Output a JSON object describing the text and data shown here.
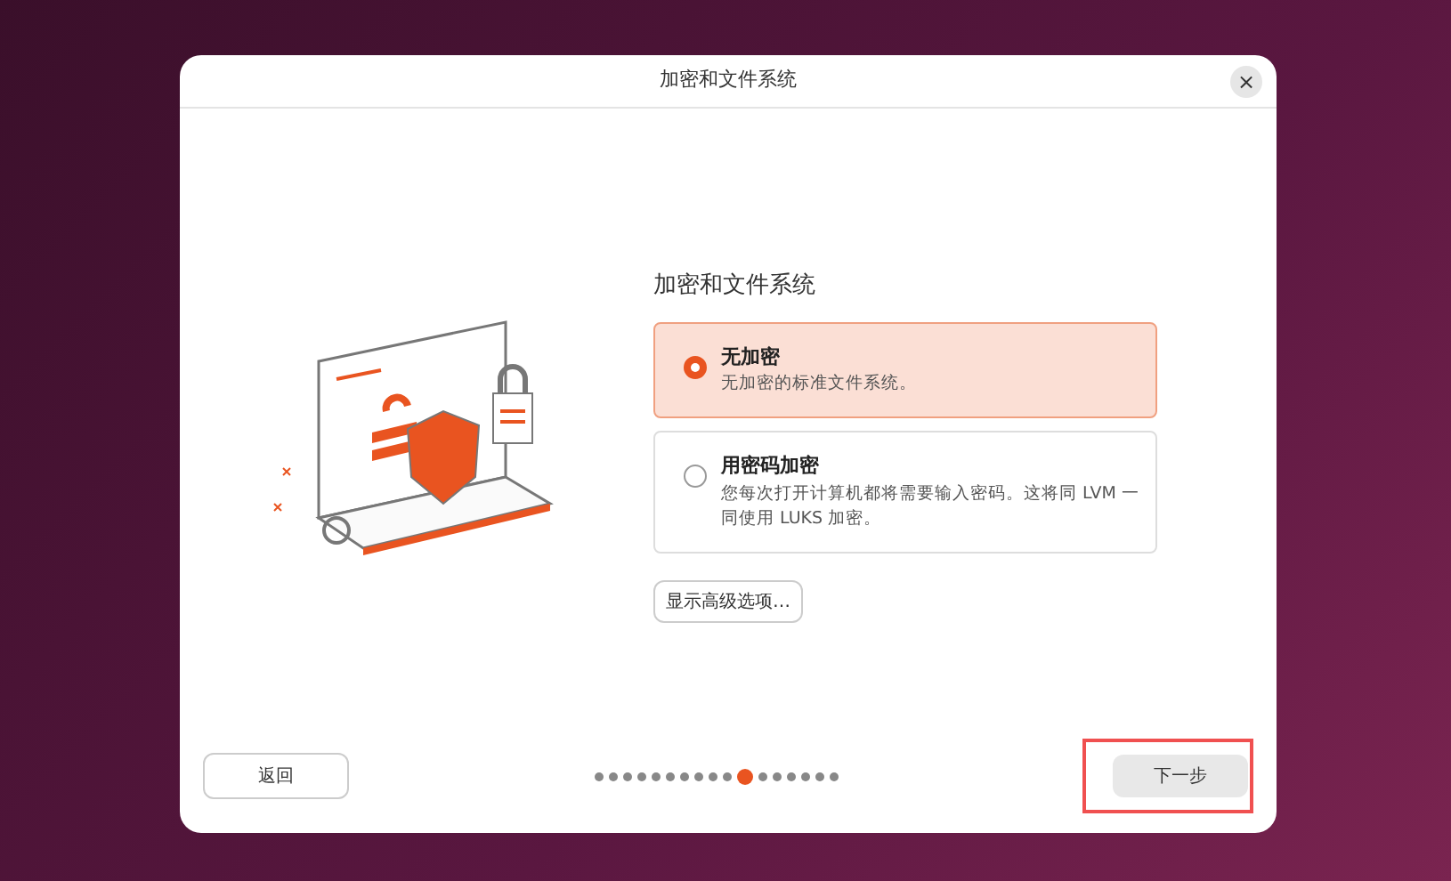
{
  "window": {
    "title": "加密和文件系统",
    "close": "×"
  },
  "heading": "加密和文件系统",
  "options": [
    {
      "label": "无加密",
      "description": "无加密的标准文件系统。",
      "selected": true
    },
    {
      "label": "用密码加密",
      "description": "您每次打开计算机都将需要输入密码。这将同 LVM 一同使用 LUKS 加密。",
      "selected": false
    }
  ],
  "advanced_button": "显示高级选项…",
  "back_button": "返回",
  "next_button": {
    "label": "下一步",
    "highlighted": true
  },
  "steps": [
    {
      "selected": false
    },
    {
      "selected": false
    },
    {
      "selected": false
    },
    {
      "selected": false
    },
    {
      "selected": false
    },
    {
      "selected": false
    },
    {
      "selected": false
    },
    {
      "selected": false
    },
    {
      "selected": false
    },
    {
      "selected": false
    },
    {
      "selected": true
    },
    {
      "selected": false
    },
    {
      "selected": false
    },
    {
      "selected": false
    },
    {
      "selected": false
    },
    {
      "selected": false
    },
    {
      "selected": false
    }
  ]
}
